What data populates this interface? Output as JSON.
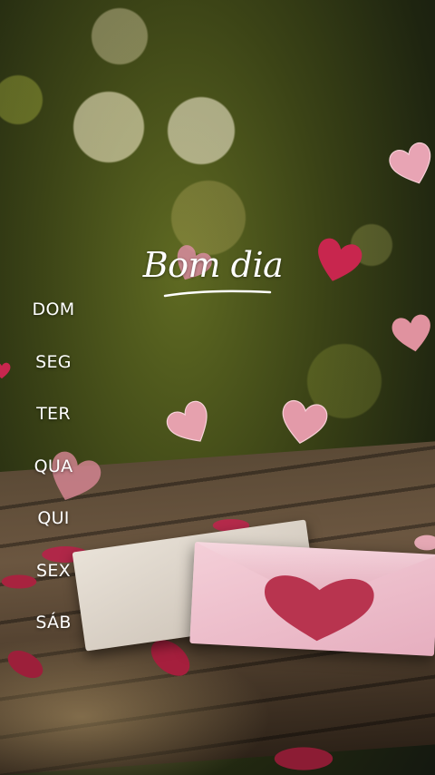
{
  "greeting": {
    "title": "Bom dia"
  },
  "weekdays": {
    "items": [
      {
        "label": "DOM"
      },
      {
        "label": "SEG"
      },
      {
        "label": "TER"
      },
      {
        "label": "QUA"
      },
      {
        "label": "QUI"
      },
      {
        "label": "SEX"
      },
      {
        "label": "SÁB"
      }
    ]
  },
  "colors": {
    "text": "#ffffff",
    "heart_pink": "#e8a4b4",
    "heart_red": "#c8264e",
    "envelope_pink": "#f0c4cf"
  },
  "icons": {
    "heart": "heart-icon",
    "envelope": "envelope-icon"
  }
}
